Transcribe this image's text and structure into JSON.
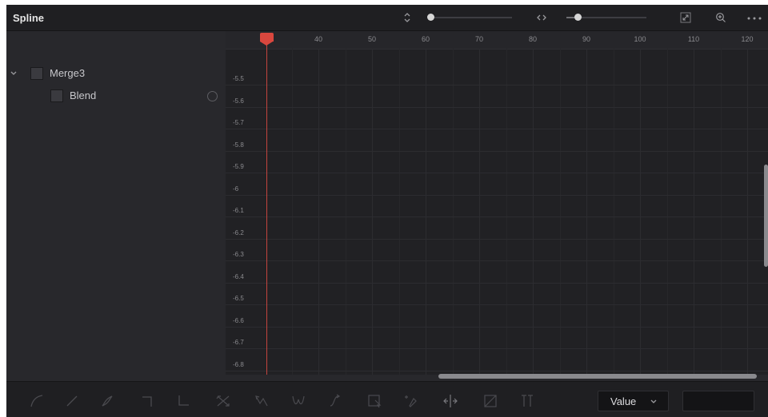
{
  "panel": {
    "title": "Spline"
  },
  "header": {
    "vertical_zoom_icon": "updown-chevron-icon",
    "horizontal_zoom_icon": "leftright-chevron-icon",
    "fit_icon": "expand-icon",
    "zoom_icon": "zoom-plus-icon",
    "more_icon": "more-dots-icon",
    "vertical_zoom_level": 0.05,
    "horizontal_zoom_level": 0.15
  },
  "tree": {
    "nodes": [
      {
        "label": "Merge3",
        "expanded": true
      },
      {
        "label": "Blend"
      }
    ]
  },
  "graph": {
    "x_ticks": [
      "40",
      "50",
      "60",
      "70",
      "80",
      "90",
      "100",
      "110",
      "120"
    ],
    "y_ticks": [
      "-5.5",
      "-5.6",
      "-5.7",
      "-5.8",
      "-5.9",
      "-6",
      "-6.1",
      "-6.2",
      "-6.3",
      "-6.4",
      "-6.5",
      "-6.6",
      "-6.7",
      "-6.8"
    ],
    "playhead_color": "#d9473e"
  },
  "bottombar": {
    "tools": [
      "smooth-icon",
      "linear-icon",
      "invert-icon",
      "step-in-icon",
      "step-out-icon",
      "reverse-icon",
      "set-loop-icon",
      "ping-pong-icon",
      "relative-loop-icon",
      "select-all-icon",
      "add-point-icon",
      "time-stretch-icon",
      "shape-box-icon",
      "show-key-markers-icon"
    ],
    "mode_select": "Value",
    "value_field": ""
  }
}
